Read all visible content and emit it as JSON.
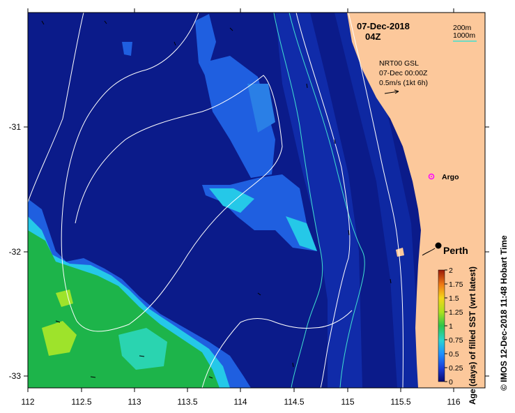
{
  "header": {
    "date": "07-Dec-2018",
    "hour": "04Z"
  },
  "bathy_legend": {
    "depth1": "200m",
    "depth2": "1000m",
    "color1": "#ffffff",
    "color2": "#40e0d0"
  },
  "current_info": {
    "line1": "NRT00 GSL",
    "line2": "07-Dec 00:00Z",
    "line3": "0.5m/s (1kt 6h)"
  },
  "places": {
    "argo": "Argo",
    "perth": "Perth"
  },
  "axes": {
    "x_ticks": [
      "112",
      "112.5",
      "113",
      "113.5",
      "114",
      "114.5",
      "115",
      "115.5",
      "116"
    ],
    "y_ticks": [
      "-31",
      "-32",
      "-33"
    ]
  },
  "colorbar": {
    "title": "Age (days) of filled SST (wrt latest)",
    "ticks": [
      "2",
      "1.75",
      "1.5",
      "1.25",
      "1",
      "0.75",
      "0.5",
      "0.25",
      "0"
    ]
  },
  "credit": "© IMOS 12-Dec-2018 11:48 Hobart Time",
  "colors": {
    "ocean_deep": "#0b1b8a",
    "land": "#fcc89b",
    "green": "#1db44a",
    "lime": "#9ee32b",
    "cyan": "#25c8e8",
    "blue": "#1f5fe0"
  }
}
